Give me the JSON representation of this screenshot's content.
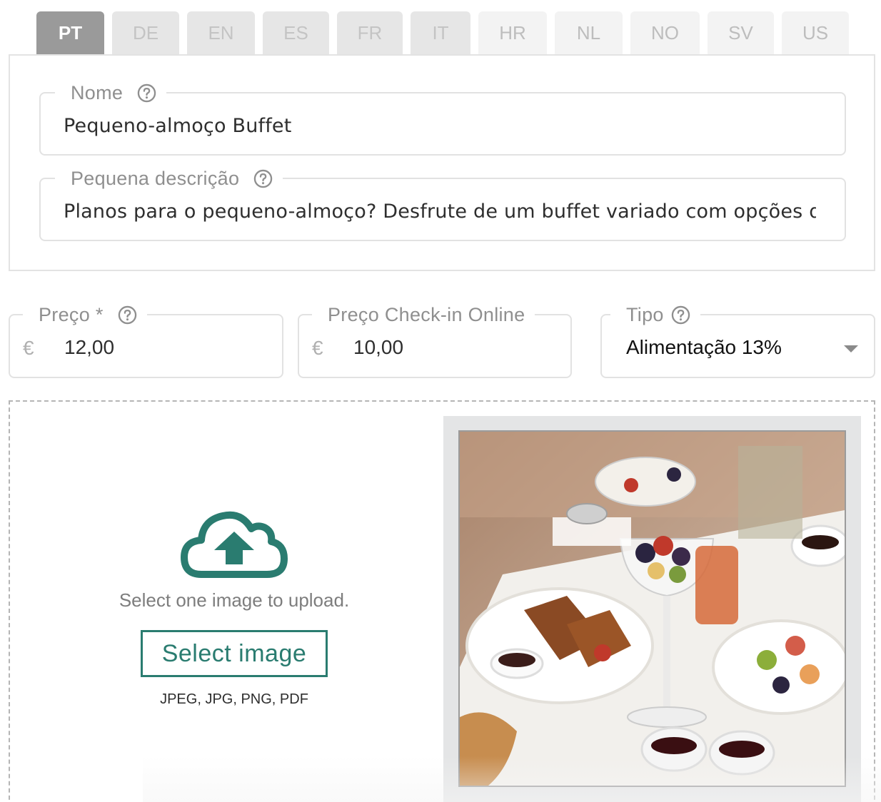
{
  "tabs": [
    {
      "code": "PT",
      "state": "active"
    },
    {
      "code": "DE",
      "state": "normal"
    },
    {
      "code": "EN",
      "state": "normal"
    },
    {
      "code": "ES",
      "state": "normal"
    },
    {
      "code": "FR",
      "state": "normal"
    },
    {
      "code": "IT",
      "state": "normal"
    },
    {
      "code": "HR",
      "state": "light"
    },
    {
      "code": "NL",
      "state": "light"
    },
    {
      "code": "NO",
      "state": "light"
    },
    {
      "code": "SV",
      "state": "light"
    },
    {
      "code": "US",
      "state": "light"
    }
  ],
  "name_field": {
    "label": "Nome",
    "value": "Pequeno-almoço Buffet"
  },
  "description_field": {
    "label": "Pequena descrição",
    "value": "Planos para o pequeno-almoço? Desfrute de um buffet variado com opções quente"
  },
  "price_field": {
    "label": "Preço *",
    "currency": "€",
    "value": "12,00"
  },
  "checkin_price_field": {
    "label": "Preço Check-in Online",
    "currency": "€",
    "value": "10,00"
  },
  "type_field": {
    "label": "Tipo",
    "value": "Alimentação 13%"
  },
  "upload": {
    "instruction": "Select one image to upload.",
    "button_label": "Select image",
    "formats": "JPEG, JPG, PNG, PDF",
    "icon": "cloud-upload-icon"
  },
  "colors": {
    "accent": "#2a7c70",
    "active_tab": "#9a9a9a"
  }
}
